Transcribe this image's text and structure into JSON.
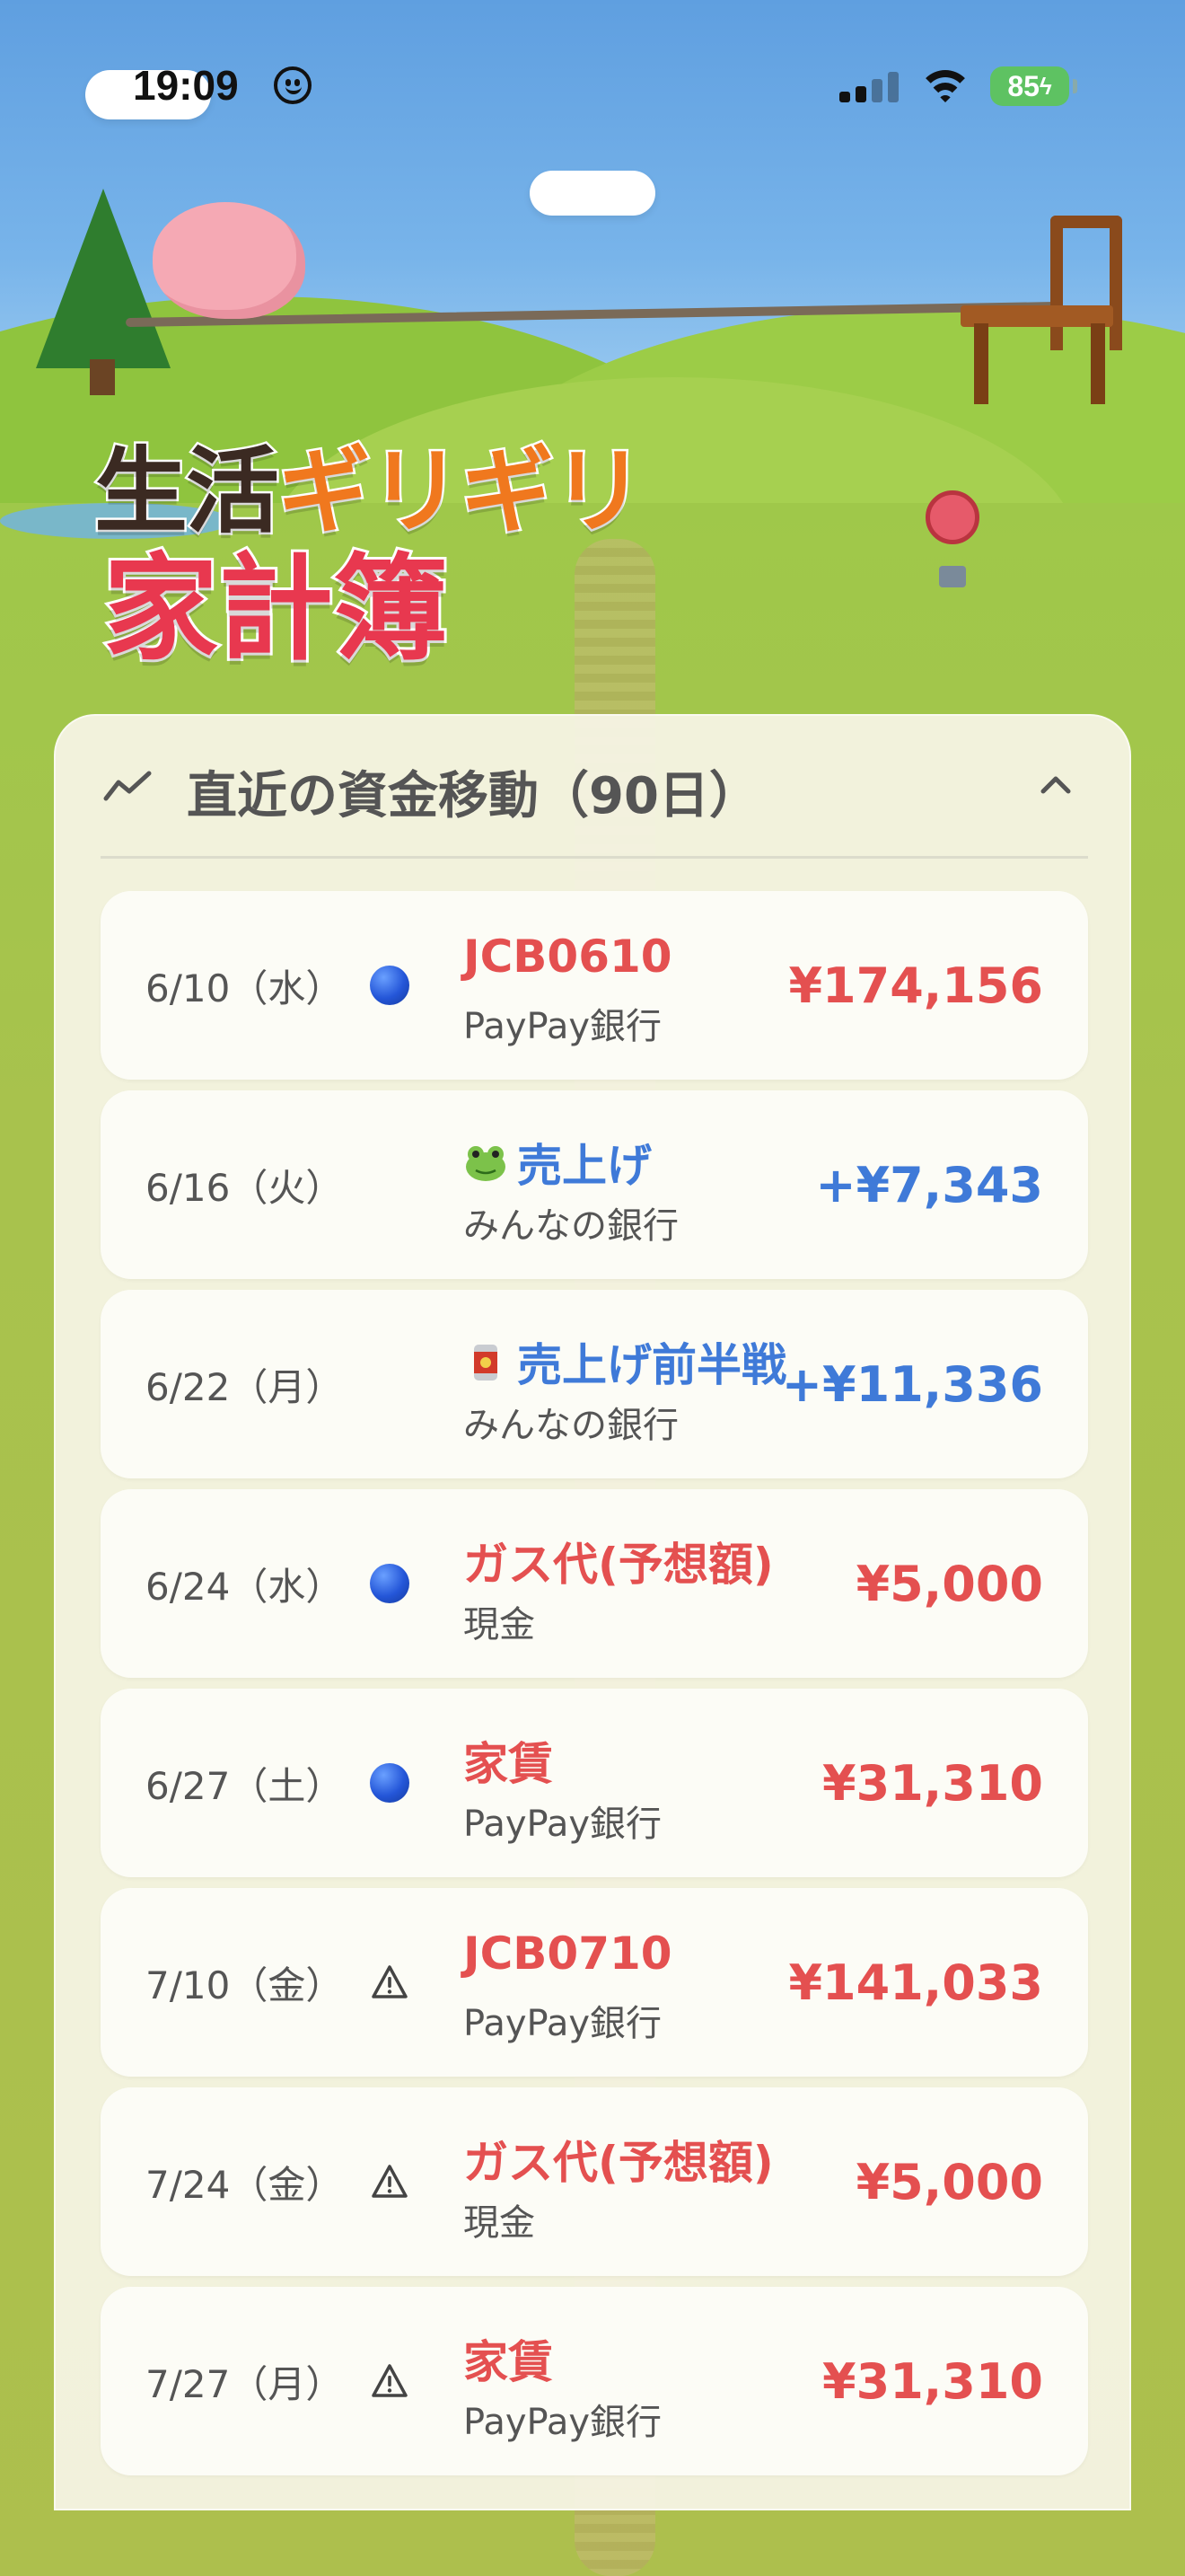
{
  "status_bar": {
    "time": "19:09",
    "battery": "85",
    "icons": [
      "smiley-icon",
      "cellular-signal-icon",
      "wifi-icon",
      "battery-charging-icon"
    ]
  },
  "title": {
    "line1_part1": "生活",
    "line1_part2": "ギリギリ",
    "line2": "家計簿"
  },
  "colors": {
    "expense": "#e45050",
    "income": "#3f7ad8",
    "title_orange": "#f0781e",
    "title_red": "#e8384f",
    "title_dark": "#3b2a22"
  },
  "panel": {
    "title": "直近の資金移動（90日）",
    "icon": "trend-chart-icon",
    "toggle_icon": "chevron-up-icon",
    "rows": [
      {
        "date": "6/10（水）",
        "marker": "blue-circle",
        "emoji": "",
        "name": "JCB0610",
        "account": "PayPay銀行",
        "amount": "¥174,156",
        "type": "expense"
      },
      {
        "date": "6/16（火）",
        "marker": "",
        "emoji": "frog",
        "name": "売上げ",
        "account": "みんなの銀行",
        "amount": "+¥7,343",
        "type": "income"
      },
      {
        "date": "6/22（月）",
        "marker": "",
        "emoji": "can",
        "name": "売上げ前半戦",
        "account": "みんなの銀行",
        "amount": "+¥11,336",
        "type": "income"
      },
      {
        "date": "6/24（水）",
        "marker": "blue-circle",
        "emoji": "",
        "name": "ガス代(予想額)",
        "account": "現金",
        "amount": "¥5,000",
        "type": "expense"
      },
      {
        "date": "6/27（土）",
        "marker": "blue-circle",
        "emoji": "",
        "name": "家賃",
        "account": "PayPay銀行",
        "amount": "¥31,310",
        "type": "expense"
      },
      {
        "date": "7/10（金）",
        "marker": "warning",
        "emoji": "",
        "name": "JCB0710",
        "account": "PayPay銀行",
        "amount": "¥141,033",
        "type": "expense"
      },
      {
        "date": "7/24（金）",
        "marker": "warning",
        "emoji": "",
        "name": "ガス代(予想額)",
        "account": "現金",
        "amount": "¥5,000",
        "type": "expense"
      },
      {
        "date": "7/27（月）",
        "marker": "warning",
        "emoji": "",
        "name": "家賃",
        "account": "PayPay銀行",
        "amount": "¥31,310",
        "type": "expense"
      }
    ]
  }
}
